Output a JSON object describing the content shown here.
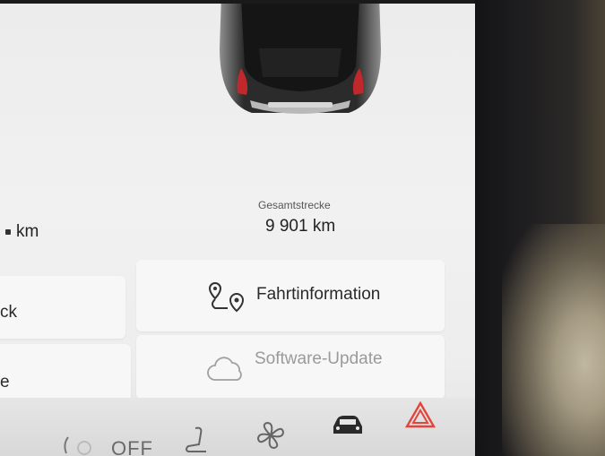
{
  "trip": {
    "left_value_unit": "km",
    "total_label": "Gesamtstrecke",
    "total_value": "9 901 km"
  },
  "tiles": {
    "left_top_fragment": "ck",
    "left_bottom_fragment": "e",
    "trip_info": "Fahrtinformation",
    "software_update": "Software-Update"
  },
  "bottom_bar": {
    "climate_status": "OFF",
    "icons": [
      "seat-heater-icon",
      "seat-icon",
      "fan-icon",
      "car-icon",
      "hazard-icon"
    ]
  },
  "colors": {
    "hazard": "#e2453b",
    "screen_bg": "#ececec"
  }
}
